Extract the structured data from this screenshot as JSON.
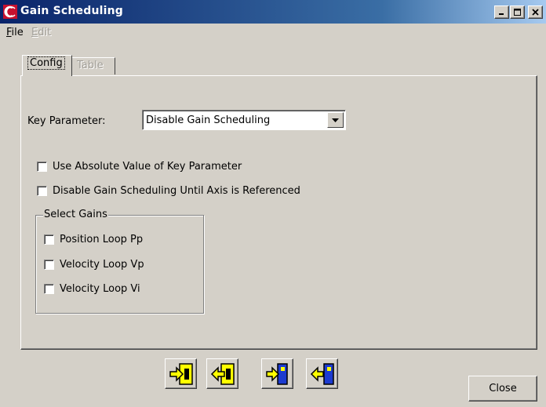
{
  "window": {
    "title": "Gain Scheduling",
    "app_icon": "crane-logo-icon",
    "controls": [
      "minimize-icon",
      "maximize-icon",
      "close-icon"
    ]
  },
  "menu": {
    "file": {
      "prefix": "",
      "accel": "F",
      "rest": "ile",
      "enabled": true
    },
    "edit": {
      "prefix": "",
      "accel": "E",
      "rest": "dit",
      "enabled": false
    }
  },
  "tabs": [
    {
      "label": "Config",
      "active": true
    },
    {
      "label": "Table",
      "active": false,
      "enabled": false
    }
  ],
  "config": {
    "key_parameter_label": "Key Parameter:",
    "key_parameter_value": "Disable Gain Scheduling",
    "options": [
      {
        "label": "Use Absolute Value of Key Parameter",
        "checked": false
      },
      {
        "label": "Disable Gain Scheduling Until Axis is Referenced",
        "checked": false
      }
    ],
    "select_gains": {
      "title": "Select Gains",
      "items": [
        {
          "label": "Position Loop Pp",
          "checked": false
        },
        {
          "label": "Velocity Loop Vp",
          "checked": false
        },
        {
          "label": "Velocity Loop Vi",
          "checked": false
        }
      ]
    }
  },
  "toolbar": {
    "buttons": [
      {
        "icon": "import-into-drive-icon"
      },
      {
        "icon": "export-from-drive-icon"
      },
      {
        "icon": "import-into-file-icon"
      },
      {
        "icon": "export-from-file-icon"
      }
    ]
  },
  "footer": {
    "close_label": "Close"
  },
  "colors": {
    "titlebar_start": "#0a246a",
    "titlebar_end": "#a6caf0",
    "face": "#d4d0c8",
    "disabled_text": "#a09d96",
    "icon_yellow": "#ffff00",
    "icon_blue": "#1c3bd0"
  }
}
